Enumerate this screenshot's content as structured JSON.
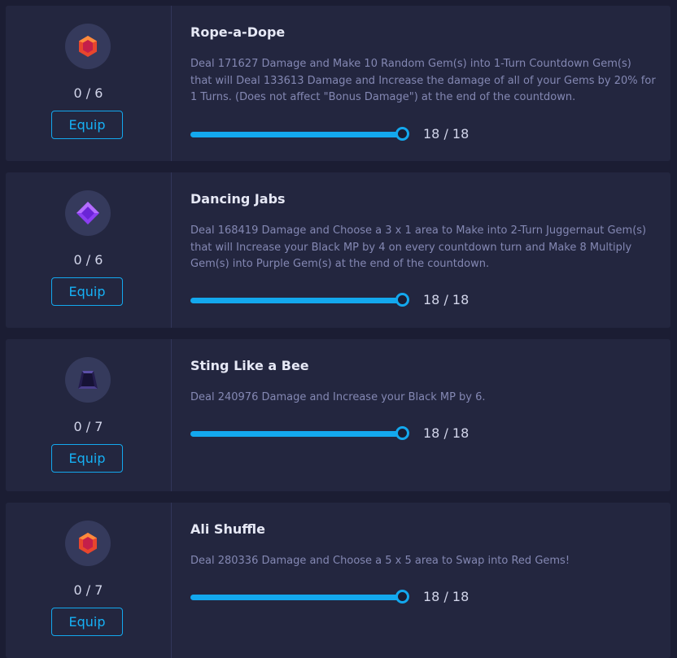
{
  "skills": [
    {
      "name": "Rope-a-Dope",
      "gem_icon": "red-gem-icon",
      "gem_color": "#e7462d",
      "count": "0 / 6",
      "equip_label": "Equip",
      "description": "Deal 171627 Damage and Make 10 Random Gem(s) into 1-Turn Countdown Gem(s) that will Deal 133613 Damage and Increase the damage of all of your Gems by 20% for 1 Turns. (Does not affect \"Bonus Damage\") at the end of the countdown.",
      "level": "18 / 18",
      "level_fraction": 1.0
    },
    {
      "name": "Dancing Jabs",
      "gem_icon": "purple-gem-icon",
      "gem_color": "#8b3df2",
      "count": "0 / 6",
      "equip_label": "Equip",
      "description": "Deal 168419 Damage and Choose a 3 x 1 area to Make into 2-Turn Juggernaut Gem(s) that will Increase your Black MP by 4 on every countdown turn and Make 8 Multiply Gem(s) into Purple Gem(s) at the end of the countdown.",
      "level": "18 / 18",
      "level_fraction": 1.0
    },
    {
      "name": "Sting Like a Bee",
      "gem_icon": "black-gem-icon",
      "gem_color": "#241d4e",
      "count": "0 / 7",
      "equip_label": "Equip",
      "description": "Deal 240976 Damage and Increase your Black MP by 6.",
      "level": "18 / 18",
      "level_fraction": 1.0
    },
    {
      "name": "Ali Shuffle",
      "gem_icon": "red-gem-icon",
      "gem_color": "#e7462d",
      "count": "0 / 7",
      "equip_label": "Equip",
      "description": "Deal 280336 Damage and Choose a 5 x 5 area to Swap into Red Gems!",
      "level": "18 / 18",
      "level_fraction": 1.0
    }
  ],
  "colors": {
    "accent": "#13a8ee",
    "card_background": "#23263f",
    "page_background": "#1b1d33"
  }
}
